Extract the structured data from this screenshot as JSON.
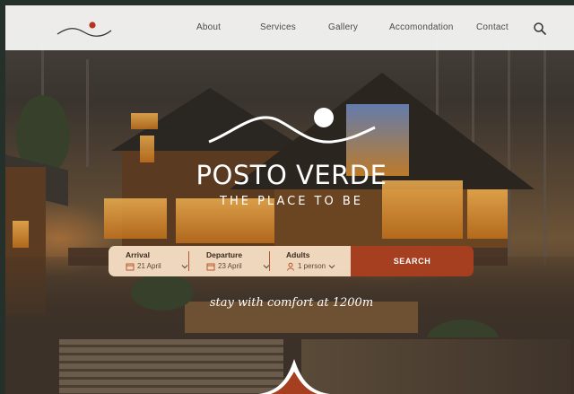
{
  "nav": {
    "items": [
      {
        "label": "About"
      },
      {
        "label": "Services"
      },
      {
        "label": "Gallery"
      },
      {
        "label": "Accomondation"
      },
      {
        "label": "Contact"
      }
    ],
    "search_icon": "search-icon",
    "logo_icon": "wave-sun-logo"
  },
  "hero": {
    "title": "POSTO VERDE",
    "subtitle": "THE PLACE TO BE",
    "tagline": "stay with comfort at 1200m",
    "logo_icon": "mountain-sun-logo"
  },
  "booking": {
    "arrival_label": "Arrival",
    "arrival_value": "21 April",
    "departure_label": "Departure",
    "departure_value": "23 April",
    "adults_label": "Adults",
    "adults_value": "1 person",
    "search_label": "SEARCH"
  },
  "colors": {
    "accent": "#a63e20",
    "navbar_bg": "#f4f4f2",
    "booking_bg": "#f6dec4",
    "logo_dot": "#b5341f",
    "text_white": "#ffffff"
  }
}
